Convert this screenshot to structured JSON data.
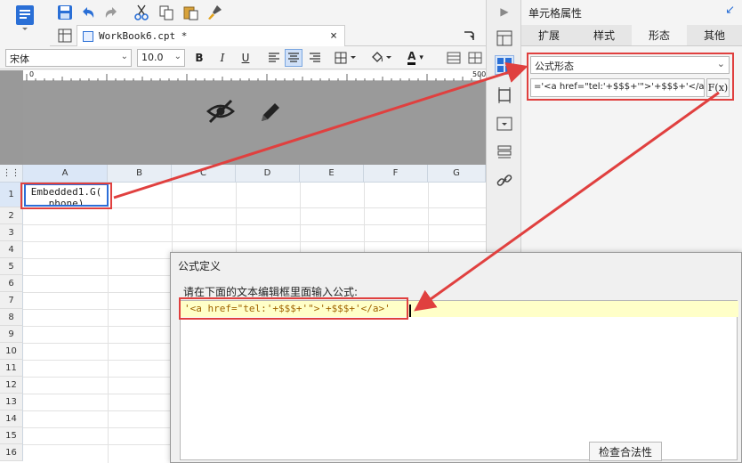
{
  "tab": {
    "filename": "WorkBook6.cpt *"
  },
  "format_bar": {
    "font_name": "宋体",
    "font_size": "10.0",
    "bold": "B",
    "italic": "I",
    "underline": "U",
    "font_color_letter": "A"
  },
  "ruler": {
    "start": "0",
    "end": "500"
  },
  "grid": {
    "columns": [
      "A",
      "B",
      "C",
      "D",
      "E",
      "F",
      "G"
    ],
    "rows": [
      "1",
      "2",
      "3",
      "4",
      "5",
      "6",
      "7",
      "8",
      "9",
      "10",
      "11",
      "12",
      "13",
      "14",
      "15",
      "16"
    ],
    "cell_a1": "Embedded1.G(\nphone)"
  },
  "right_panel": {
    "title": "单元格属性",
    "tabs": [
      "扩展",
      "样式",
      "形态",
      "其他"
    ],
    "active_tab": "形态",
    "shape_select": "公式形态",
    "formula_value": "='<a href=\"tel:'+$$$+'\">'+$$$+'</a>'",
    "fx_label": "F(x)"
  },
  "dialog": {
    "title": "公式定义",
    "instruction": "请在下面的文本编辑框里面输入公式:",
    "code": "'<a href=\"tel:'+$$$+'\">'+$$$+'</a>'",
    "check_button": "检查合法性"
  },
  "colors": {
    "accent": "#2c6ed8",
    "annotation": "#e0403f",
    "editor_highlight": "#ffffc8",
    "code_text": "#a06400"
  }
}
